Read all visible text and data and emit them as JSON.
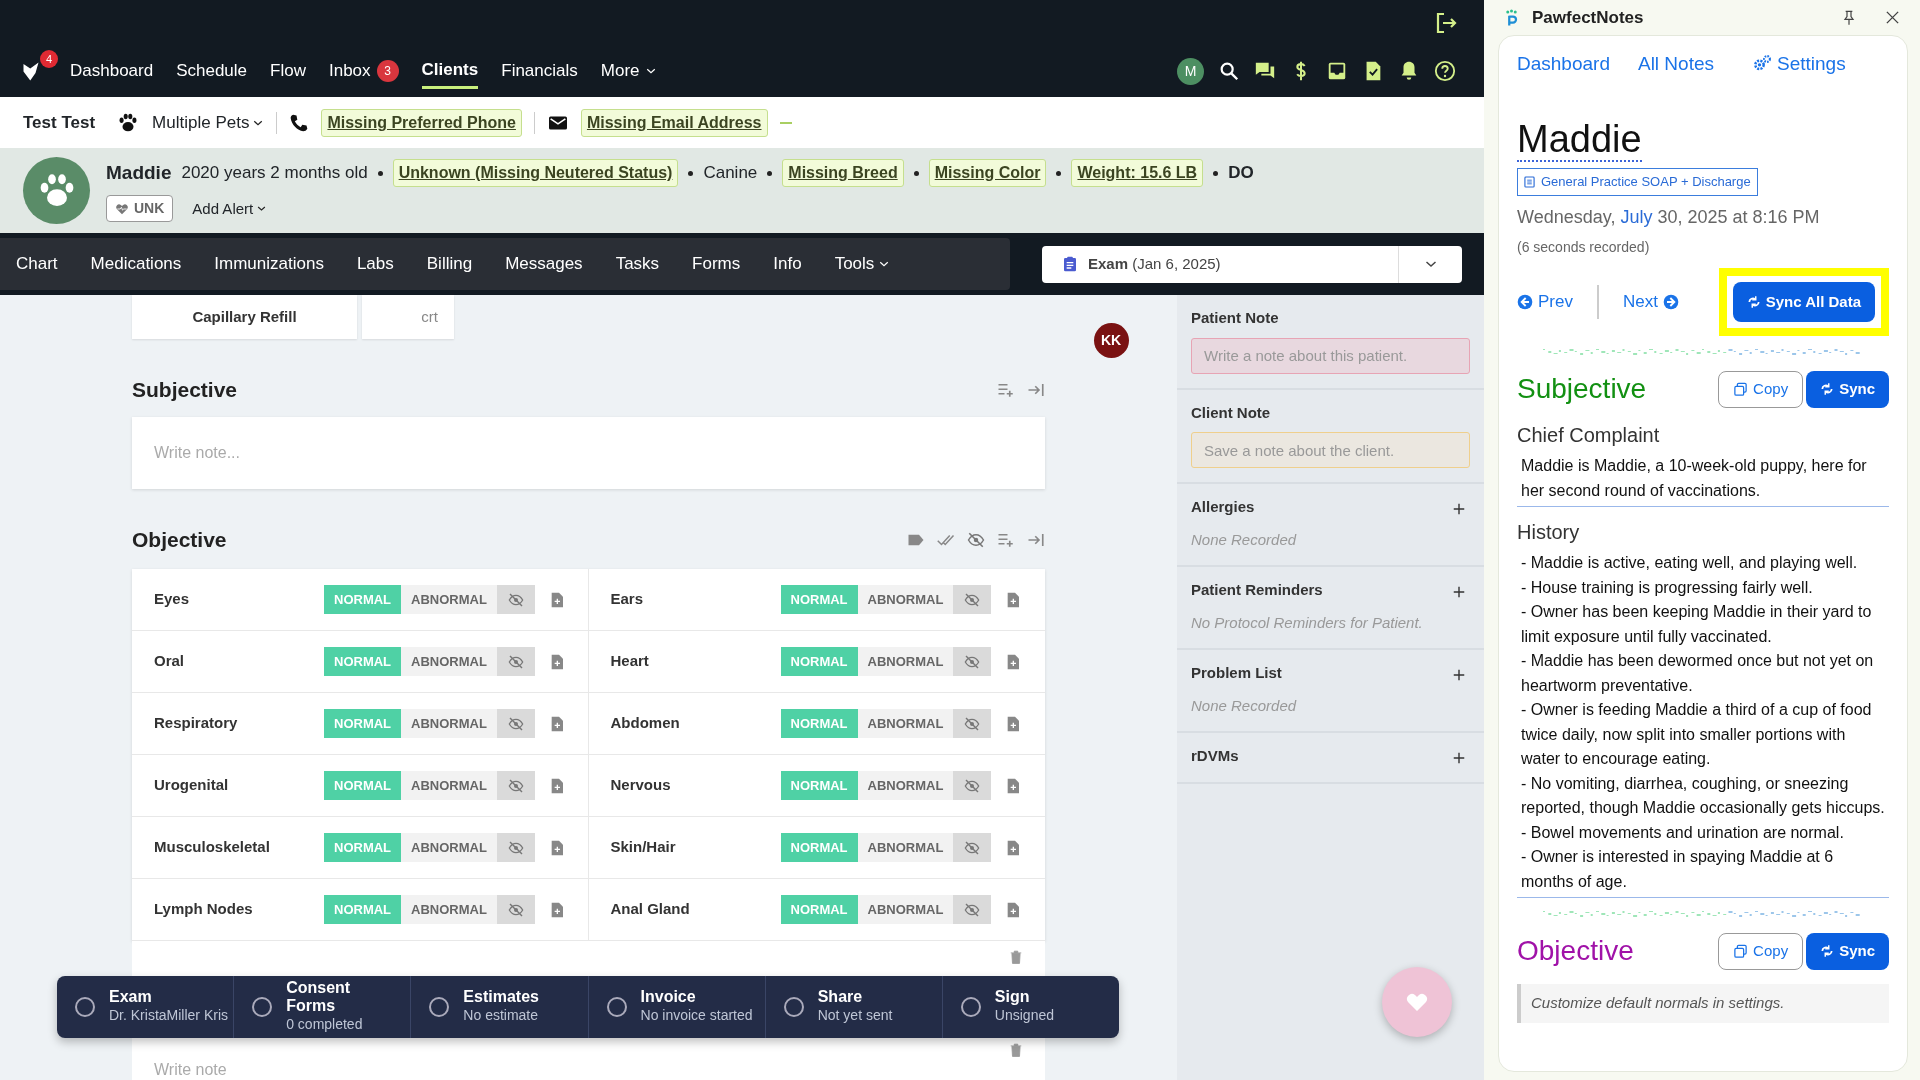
{
  "app_nav": {
    "logo_badge": "4",
    "items": [
      {
        "label": "Dashboard",
        "selected": false
      },
      {
        "label": "Schedule",
        "selected": false
      },
      {
        "label": "Flow",
        "selected": false
      },
      {
        "label": "Inbox",
        "selected": false,
        "badge": "3"
      },
      {
        "label": "Clients",
        "selected": true
      },
      {
        "label": "Financials",
        "selected": false
      },
      {
        "label": "More",
        "selected": false,
        "kind": "dropdown"
      }
    ],
    "user_avatar": "M"
  },
  "client": {
    "name": "Test Test",
    "pets": "Multiple Pets",
    "phone": "Missing Preferred Phone",
    "email": "Missing Email Address"
  },
  "patient": {
    "name": "Maddie",
    "age": "2020 years 2 months old",
    "details": [
      {
        "text": "Unknown (Missing Neutered Status)",
        "kind": "tag"
      },
      {
        "text": "Canine",
        "kind": "plain"
      },
      {
        "text": "Missing Breed",
        "kind": "tag"
      },
      {
        "text": "Missing Color",
        "kind": "tag"
      },
      {
        "text": "Weight: 15.6 LB",
        "kind": "tag"
      },
      {
        "text": "DO",
        "kind": "bold"
      }
    ],
    "status": "UNK",
    "alert": "Add Alert"
  },
  "record_tabs": [
    {
      "label": "Chart",
      "selected": false
    },
    {
      "label": "Medications",
      "selected": false
    },
    {
      "label": "Immunizations",
      "selected": false
    },
    {
      "label": "Labs",
      "selected": false
    },
    {
      "label": "Billing",
      "selected": false
    },
    {
      "label": "Messages",
      "selected": false
    },
    {
      "label": "Tasks",
      "selected": false
    },
    {
      "label": "Forms",
      "selected": false
    },
    {
      "label": "Info",
      "selected": false
    },
    {
      "label": "Tools",
      "selected": false,
      "kind": "dropdown"
    }
  ],
  "exam_select": {
    "type": "Exam",
    "date": "(Jan 6, 2025)"
  },
  "vitals": [
    {
      "text": "Capillary Refill"
    },
    {
      "text": "crt"
    }
  ],
  "user_avatar": "KK",
  "subjective": {
    "title": "Subjective",
    "placeholder": "Write note..."
  },
  "objective": {
    "title": "Objective",
    "systems": [
      {
        "name": "Eyes",
        "normal": "NORMAL",
        "abnormal": "ABNORMAL",
        "is_normal": true
      },
      {
        "name": "Ears",
        "normal": "NORMAL",
        "abnormal": "ABNORMAL",
        "is_normal": true
      },
      {
        "name": "Oral",
        "normal": "NORMAL",
        "abnormal": "ABNORMAL",
        "is_normal": true
      },
      {
        "name": "Heart",
        "normal": "NORMAL",
        "abnormal": "ABNORMAL",
        "is_normal": true
      },
      {
        "name": "Respiratory",
        "normal": "NORMAL",
        "abnormal": "ABNORMAL",
        "is_normal": true
      },
      {
        "name": "Abdomen",
        "normal": "NORMAL",
        "abnormal": "ABNORMAL",
        "is_normal": true
      },
      {
        "name": "Urogenital",
        "normal": "NORMAL",
        "abnormal": "ABNORMAL",
        "is_normal": true
      },
      {
        "name": "Nervous",
        "normal": "NORMAL",
        "abnormal": "ABNORMAL",
        "is_normal": true
      },
      {
        "name": "Musculoskeletal",
        "normal": "NORMAL",
        "abnormal": "ABNORMAL",
        "is_normal": true
      },
      {
        "name": "Skin/Hair",
        "normal": "NORMAL",
        "abnormal": "ABNORMAL",
        "is_normal": true
      },
      {
        "name": "Lymph Nodes",
        "normal": "NORMAL",
        "abnormal": "ABNORMAL",
        "is_normal": true
      },
      {
        "name": "Anal Gland",
        "normal": "NORMAL",
        "abnormal": "ABNORMAL",
        "is_normal": true
      }
    ]
  },
  "lower_note": {
    "placeholder": "Write note"
  },
  "workflow": [
    {
      "title": "Exam",
      "subtitle": "Dr. KristaMiller Kris",
      "checked": false
    },
    {
      "title": "Consent Forms",
      "subtitle": "0 completed",
      "checked": false
    },
    {
      "title": "Estimates",
      "subtitle": "No estimate",
      "checked": false
    },
    {
      "title": "Invoice",
      "subtitle": "No invoice started",
      "checked": false
    },
    {
      "title": "Share",
      "subtitle": "Not yet sent",
      "checked": false
    },
    {
      "title": "Sign",
      "subtitle": "Unsigned",
      "checked": false
    }
  ],
  "sidebar": {
    "notes": [
      {
        "label": "Patient Note",
        "placeholder": "Write a note about this patient.",
        "kind": "patient"
      },
      {
        "label": "Client Note",
        "placeholder": "Save a note about the client.",
        "kind": "client"
      }
    ],
    "sections": [
      {
        "title": "Allergies",
        "empty": "None Recorded"
      },
      {
        "title": "Patient Reminders",
        "empty": "No Protocol Reminders for Patient."
      },
      {
        "title": "Problem List",
        "empty": "None Recorded"
      },
      {
        "title": "rDVMs"
      }
    ]
  },
  "plugin": {
    "title": "PawfectNotes",
    "nav": [
      {
        "label": "Dashboard",
        "kind": "link"
      },
      {
        "label": "All Notes",
        "kind": "link"
      },
      {
        "label": "Settings",
        "kind": "settings"
      }
    ],
    "patient": "Maddie",
    "template": "General Practice SOAP + Discharge",
    "date_start": "Wednesday,",
    "date_month": "July",
    "date_end": "30, 2025 at 8:16 PM",
    "recorded": "(6 seconds recorded)",
    "prev": "Prev",
    "next": "Next",
    "sync_all": {
      "label": "Sync All Data",
      "highlighted": true
    },
    "sections": [
      {
        "title": "Subjective",
        "color": "#129012",
        "copy": "Copy",
        "sync": "Sync",
        "blocks": [
          {
            "heading": "Chief Complaint",
            "lines": [
              "Maddie is Maddie, a 10-week-old puppy, here for her second round of vaccinations."
            ]
          },
          {
            "heading": "History",
            "lines": [
              "- Maddie is active, eating well, and playing well.",
              "- House training is progressing fairly well.",
              "- Owner has been keeping Maddie in their yard to limit exposure until fully vaccinated.",
              "- Maddie has been dewormed once but not yet on heartworm preventative.",
              "- Owner is feeding Maddie a third of a cup of food twice daily, now split into smaller portions with water to encourage eating.",
              "- No vomiting, diarrhea, coughing, or sneezing reported, though Maddie occasionally gets hiccups.",
              "- Bowel movements and urination are normal.",
              "- Owner is interested in spaying Maddie at 6 months of age."
            ]
          }
        ]
      },
      {
        "title": "Objective",
        "color": "#a012a8",
        "copy": "Copy",
        "sync": "Sync",
        "note": "Customize default normals in",
        "note_link": "settings",
        "note_end": "."
      }
    ]
  }
}
